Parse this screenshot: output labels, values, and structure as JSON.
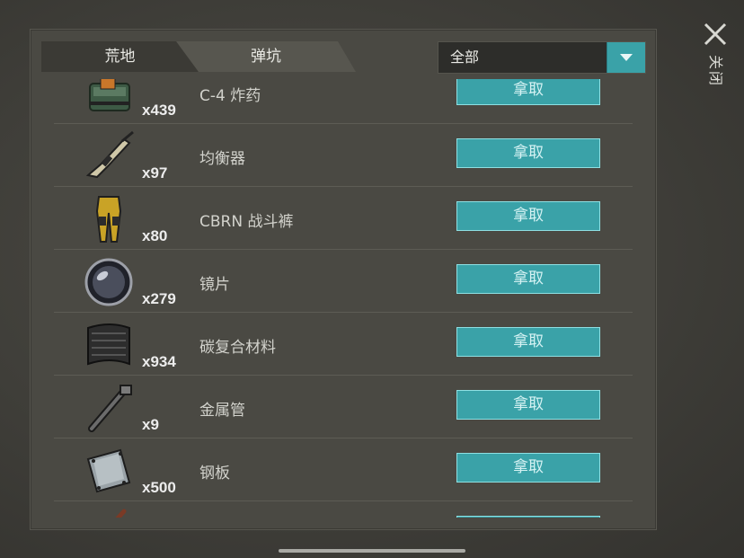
{
  "tabs": [
    "荒地",
    "弹坑"
  ],
  "filter": {
    "selected": "全部"
  },
  "take_label": "拿取",
  "close_label_line1": "关",
  "close_label_line2": "闭",
  "items": [
    {
      "name": "C-4 炸药",
      "qty": "x439",
      "icon": "c4-explosive-icon"
    },
    {
      "name": "均衡器",
      "qty": "x97",
      "icon": "rifle-icon"
    },
    {
      "name": "CBRN 战斗裤",
      "qty": "x80",
      "icon": "pants-icon"
    },
    {
      "name": "镜片",
      "qty": "x279",
      "icon": "lens-icon"
    },
    {
      "name": "碳复合材料",
      "qty": "x934",
      "icon": "carbon-sheet-icon"
    },
    {
      "name": "金属管",
      "qty": "x9",
      "icon": "metal-pipe-icon"
    },
    {
      "name": "钢板",
      "qty": "x500",
      "icon": "steel-plate-icon"
    },
    {
      "name": "",
      "qty": "",
      "icon": "rod-icon"
    }
  ]
}
